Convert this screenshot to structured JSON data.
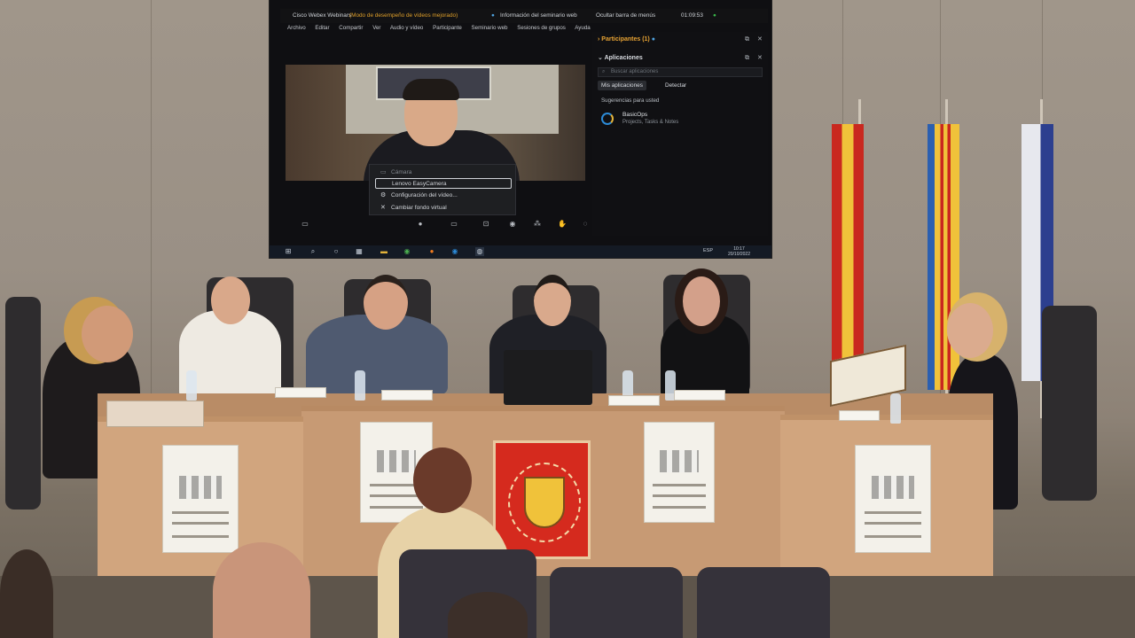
{
  "window": {
    "app_title": "Cisco Webex Webinars",
    "notice": "(Modo de desempeño de vídeos mejorado)",
    "event_info": "Información del seminario web",
    "hide_bar": "Ocultar barra de menús",
    "timer": "01:09:53"
  },
  "menu": [
    "Archivo",
    "Editar",
    "Compartir",
    "Ver",
    "Audio y vídeo",
    "Participante",
    "Seminario web",
    "Sesiones de grupos",
    "Ayuda"
  ],
  "camera_menu": {
    "header": "Cámara",
    "selected": "Lenovo EasyCamera",
    "items": [
      "Configuración del vídeo...",
      "Cambiar fondo virtual"
    ]
  },
  "panel": {
    "participants_title": "Participantes (1)",
    "apps_title": "Aplicaciones",
    "search_placeholder": "Buscar aplicaciones",
    "tabs": [
      "Mis aplicaciones",
      "Detectar"
    ],
    "suggestions_title": "Sugerencias para usted",
    "app_name": "BasicOps",
    "app_desc": "Projects, Tasks & Notes"
  },
  "taskbar": {
    "lang": "ESP",
    "time": "10:17",
    "date": "20/10/2022"
  },
  "icons": {
    "record": "record-dot-icon",
    "mic": "microphone-icon",
    "end_call": "end-call-icon"
  },
  "colors": {
    "webex_accent": "#e6a233",
    "end_call": "#e22a2a",
    "seal_red": "#d52a1e"
  }
}
